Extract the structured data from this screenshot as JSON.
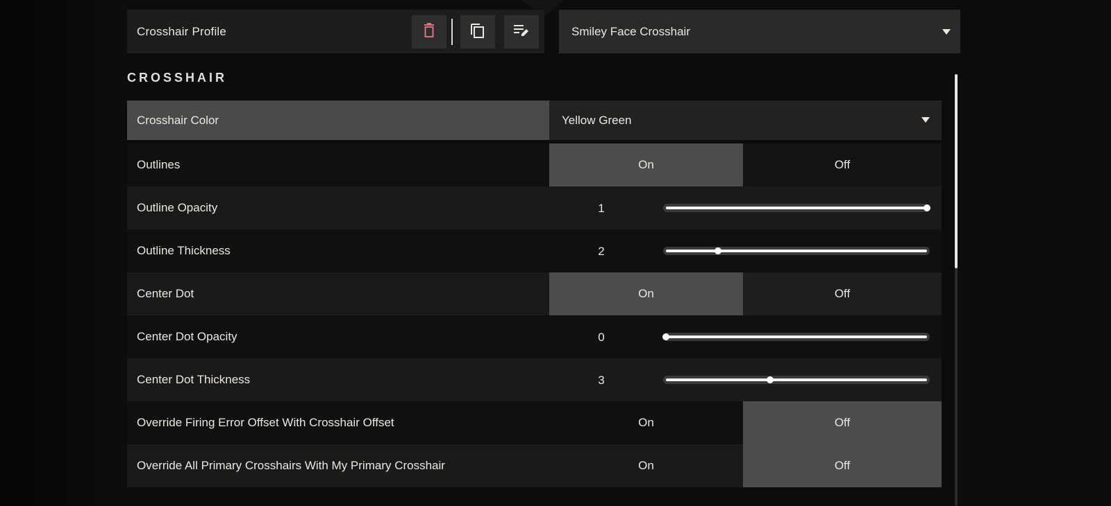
{
  "profile": {
    "label": "Crosshair Profile",
    "selected": "Smiley Face Crosshair",
    "icons": [
      "trash-icon",
      "copy-icon",
      "edit-list-icon"
    ]
  },
  "section": {
    "title": "CROSSHAIR"
  },
  "rows": [
    {
      "label": "Crosshair Color",
      "type": "dropdown",
      "value": "Yellow Green"
    },
    {
      "label": "Outlines",
      "type": "toggle",
      "on": "On",
      "off": "Off",
      "active": "on"
    },
    {
      "label": "Outline Opacity",
      "type": "slider",
      "value": "1",
      "fraction": 1.0
    },
    {
      "label": "Outline Thickness",
      "type": "slider",
      "value": "2",
      "fraction": 0.2
    },
    {
      "label": "Center Dot",
      "type": "toggle",
      "on": "On",
      "off": "Off",
      "active": "on"
    },
    {
      "label": "Center Dot Opacity",
      "type": "slider",
      "value": "0",
      "fraction": 0.0
    },
    {
      "label": "Center Dot Thickness",
      "type": "slider",
      "value": "3",
      "fraction": 0.4
    },
    {
      "label": "Override Firing Error Offset With Crosshair Offset",
      "type": "toggle",
      "on": "On",
      "off": "Off",
      "active": "off"
    },
    {
      "label": "Override All Primary Crosshairs With My Primary Crosshair",
      "type": "toggle",
      "on": "On",
      "off": "Off",
      "active": "off"
    }
  ],
  "colors": {
    "delete_icon": "#e0707a",
    "text": "#ece8e1"
  }
}
